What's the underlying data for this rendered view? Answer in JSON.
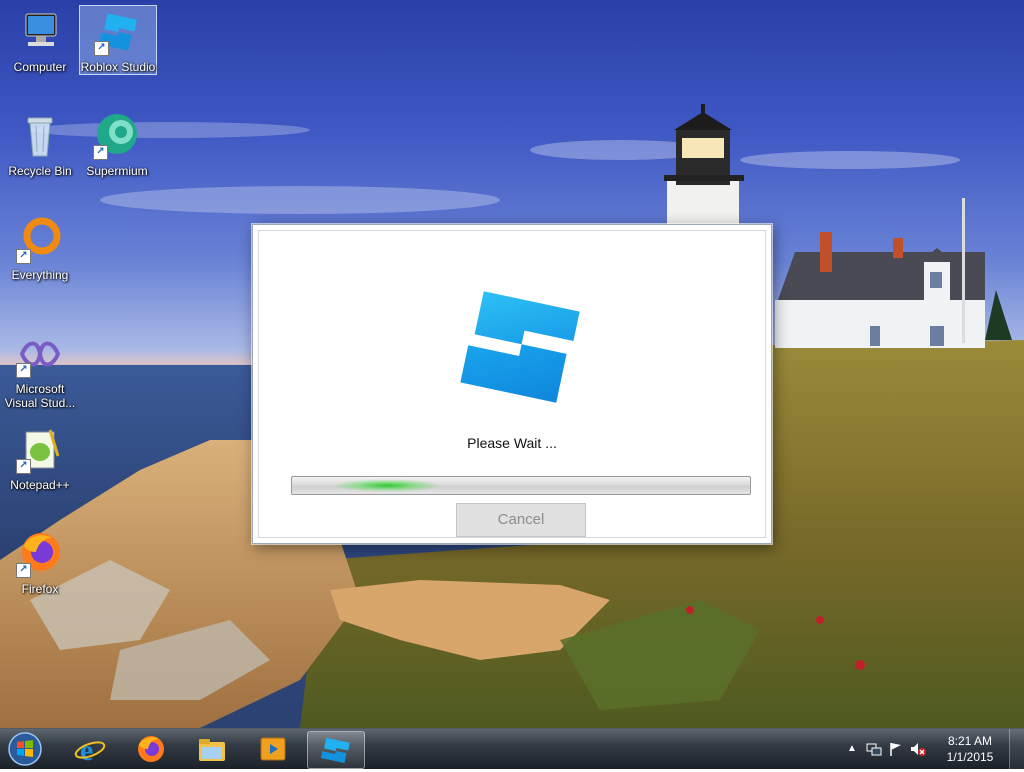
{
  "desktop": {
    "icons": [
      {
        "label": "Computer",
        "icon": "computer-icon"
      },
      {
        "label": "Roblox Studio",
        "icon": "roblox-studio-icon"
      },
      {
        "label": "Recycle Bin",
        "icon": "recycle-bin-icon"
      },
      {
        "label": "Supermium",
        "icon": "supermium-icon"
      },
      {
        "label": "Everything",
        "icon": "everything-icon"
      },
      {
        "label": "Microsoft Visual Stud...",
        "icon": "visual-studio-icon"
      },
      {
        "label": "Notepad++",
        "icon": "notepad-plus-plus-icon"
      },
      {
        "label": "Firefox",
        "icon": "firefox-icon"
      }
    ]
  },
  "dialog": {
    "status_text": "Please Wait ...",
    "cancel_label": "Cancel",
    "logo_icon": "roblox-studio-logo"
  },
  "taskbar": {
    "pinned": [
      {
        "icon": "internet-explorer-icon"
      },
      {
        "icon": "firefox-icon"
      },
      {
        "icon": "file-explorer-icon"
      },
      {
        "icon": "media-player-icon"
      },
      {
        "icon": "roblox-studio-icon"
      }
    ],
    "tray": {
      "time": "8:21 AM",
      "date": "1/1/2015",
      "icons": [
        "show-hidden-icons-arrow",
        "network-icon",
        "action-center-flag-icon",
        "volume-muted-icon"
      ]
    }
  },
  "colors": {
    "roblox_blue": "#1aa3e8",
    "progress_green": "#2ec82e",
    "taskbar_dark": "#1a222c"
  }
}
